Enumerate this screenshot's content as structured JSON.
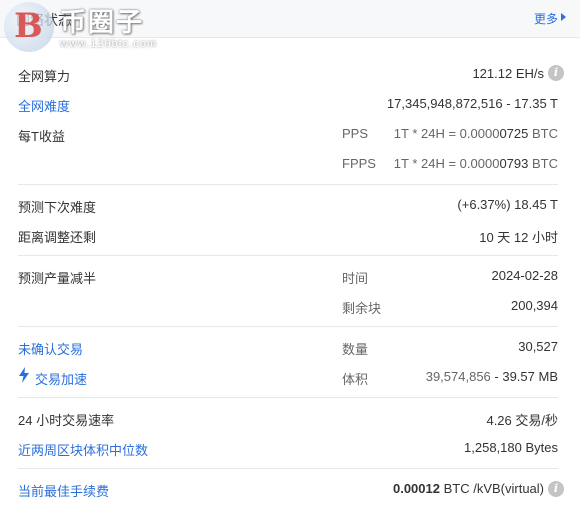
{
  "header": {
    "title": "网络状态",
    "more": "更多"
  },
  "watermark": {
    "brand": "币圈子",
    "url": "www.120btc.com",
    "logo_glyph": "B"
  },
  "hashrate": {
    "label": "全网算力",
    "value": "121.12 EH/s"
  },
  "difficulty": {
    "label": "全网难度",
    "value": "17,345,948,872,516 - 17.35 T"
  },
  "earnings": {
    "label": "每T收益",
    "pps": {
      "label": "PPS",
      "prefix": "1T * 24H = 0.0000",
      "value": "0725",
      "unit": " BTC"
    },
    "fpps": {
      "label": "FPPS",
      "prefix": "1T * 24H = 0.0000",
      "value": "0793",
      "unit": " BTC"
    }
  },
  "next_difficulty": {
    "label": "预测下次难度",
    "value": "(+6.37%) 18.45 T"
  },
  "adjust_remaining": {
    "label": "距离调整还剩",
    "value": "10 天 12 小时"
  },
  "halving": {
    "label": "预测产量减半",
    "time_label": "时间",
    "time_value": "2024-02-28",
    "blocks_label": "剩余块",
    "blocks_value": "200,394"
  },
  "unconfirmed": {
    "label": "未确认交易",
    "count_label": "数量",
    "count_value": "30,527",
    "accel_label": "交易加速",
    "size_label": "体积",
    "size_value_a": "39,574,856",
    "size_value_b": " - 39.57 MB"
  },
  "tx_rate": {
    "label": "24 小时交易速率",
    "value": "4.26 交易/秒"
  },
  "median_size": {
    "label": "近两周区块体积中位数",
    "value": "1,258,180 Bytes"
  },
  "best_fee": {
    "label": "当前最佳手续费",
    "value_bold": "0.00012",
    "value_unit": " BTC /kVB(virtual)"
  },
  "colors": {
    "link": "#2a6fdb",
    "text": "#333333",
    "muted": "#666666",
    "divider": "#e8e8e8",
    "header_bg": "#f7f8fa"
  },
  "icons": {
    "info": "info-icon",
    "accelerate": "lightning-icon",
    "more": "chevron-right-icon"
  },
  "info_glyph": "i"
}
